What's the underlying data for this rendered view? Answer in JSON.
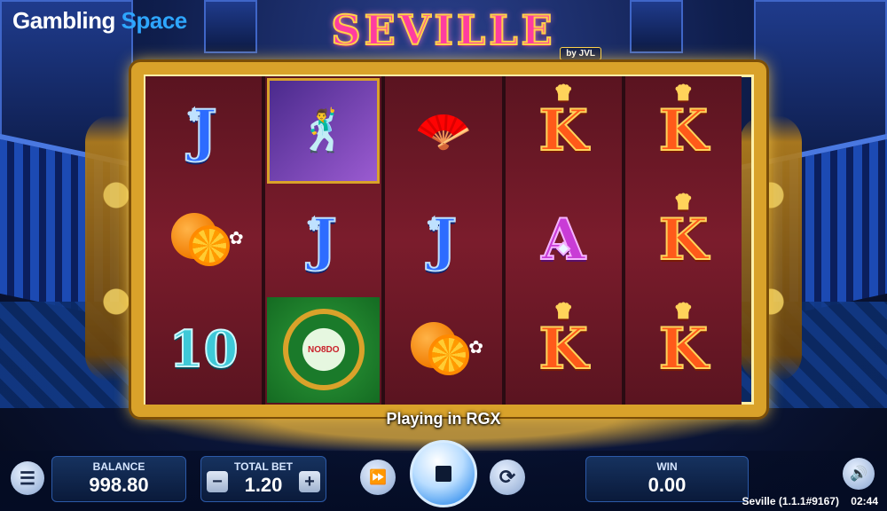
{
  "branding": {
    "watermark_part1": "Gambling",
    "watermark_part2": "Space"
  },
  "game": {
    "logo": "SEVILLE",
    "logo_by": "by JVL"
  },
  "reels": [
    [
      "J",
      "orange",
      "10"
    ],
    [
      "matador",
      "J",
      "seal"
    ],
    [
      "fan-castanets",
      "J",
      "orange"
    ],
    [
      "K",
      "A",
      "K"
    ],
    [
      "K",
      "K",
      "K"
    ]
  ],
  "symbols": {
    "J": "J",
    "K": "K",
    "A": "A",
    "10": "10"
  },
  "seal_text": "NO8DO",
  "status_message": "Playing in RGX",
  "balance": {
    "label": "BALANCE",
    "value": "998.80"
  },
  "total_bet": {
    "label": "TOTAL BET",
    "value": "1.20",
    "minus": "−",
    "plus": "+"
  },
  "win": {
    "label": "WIN",
    "value": "0.00"
  },
  "footer": {
    "version": "Seville (1.1.1#9167)",
    "time": "02:44"
  },
  "icons": {
    "menu": "menu-icon",
    "turbo": "fast-forward-icon",
    "spin": "stop-icon",
    "autoplay": "autoplay-icon",
    "sound": "speaker-icon"
  },
  "colors": {
    "accent": "#2ea6ff",
    "frame_gold": "#d9a22a",
    "reel_bg": "#7b1c2c"
  }
}
